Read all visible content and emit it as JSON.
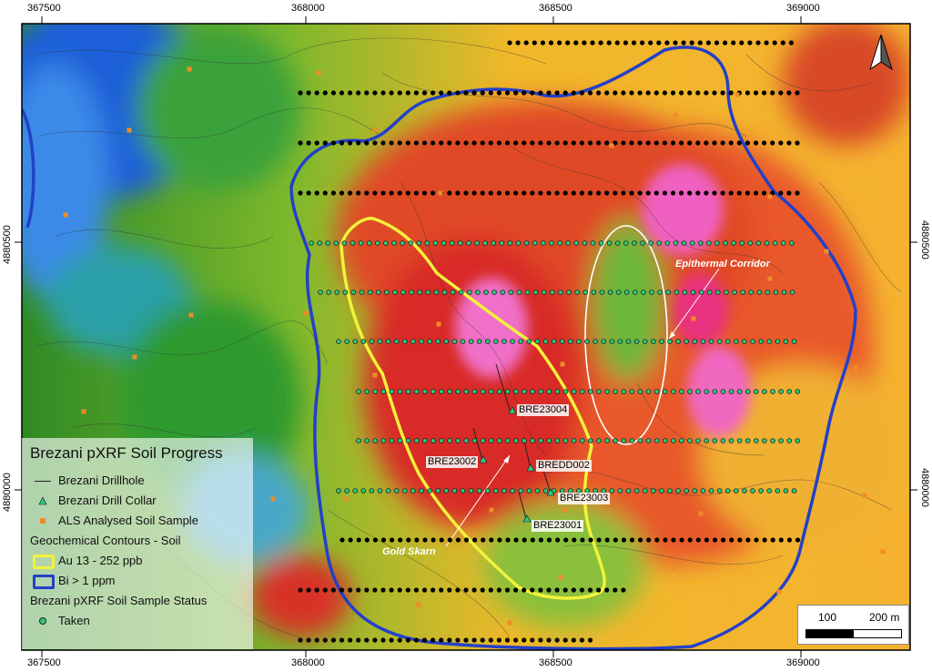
{
  "axes": {
    "x_ticks": [
      "367500",
      "368000",
      "368500",
      "369000"
    ],
    "y_ticks": [
      "4880500",
      "4880000"
    ]
  },
  "legend": {
    "title": "Brezani pXRF Soil Progress",
    "drillhole": "Brezani Drillhole",
    "drill_collar": "Brezani Drill Collar",
    "als_sample": "ALS Analysed Soil Sample",
    "contours_heading": "Geochemical Contours - Soil",
    "au_contour": "Au 13 - 252 ppb",
    "bi_contour": "Bi > 1 ppm",
    "status_heading": "Brezani pXRF Soil Sample Status",
    "taken": "Taken"
  },
  "drill_collars": [
    "BRE23004",
    "BRE23002",
    "BREDD002",
    "BRE23003",
    "BRE23001"
  ],
  "annotations": {
    "epithermal": "Epithermal Corridor",
    "skarn": "Gold Skarn"
  },
  "scale_bar": {
    "label_a": "100",
    "label_b": "200 m"
  },
  "colors": {
    "au_contour": "#f2f23a",
    "bi_contour": "#2440c8",
    "collar": "#2ecc71",
    "als_sample": "#f08c28",
    "taken": "#2ecc71"
  },
  "north_arrow": "north-arrow-icon"
}
